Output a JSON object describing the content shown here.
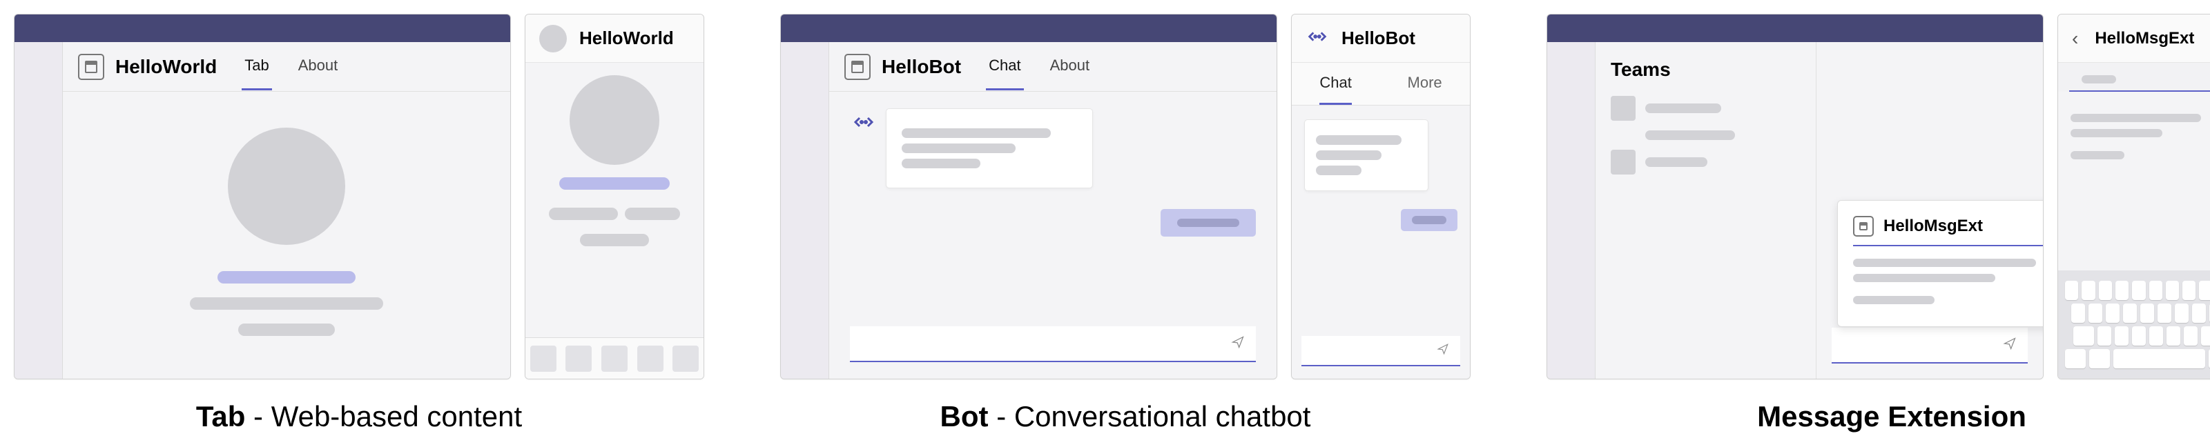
{
  "sections": {
    "tab": {
      "desktop": {
        "app_name": "HelloWorld",
        "tabs": [
          "Tab",
          "About"
        ],
        "active_tab": 0
      },
      "mobile": {
        "title": "HelloWorld"
      },
      "caption_bold": "Tab",
      "caption_rest": " - Web-based content"
    },
    "bot": {
      "desktop": {
        "app_name": "HelloBot",
        "tabs": [
          "Chat",
          "About"
        ],
        "active_tab": 0
      },
      "mobile": {
        "title": "HelloBot",
        "tabs": [
          "Chat",
          "More"
        ],
        "active_tab": 0
      },
      "caption_bold": "Bot",
      "caption_rest": " - Conversational chatbot"
    },
    "msgext": {
      "desktop": {
        "sidebar_title": "Teams",
        "popup_title": "HelloMsgExt"
      },
      "mobile": {
        "title": "HelloMsgExt"
      },
      "caption_bold": "Message Extension",
      "caption_rest": ""
    }
  }
}
